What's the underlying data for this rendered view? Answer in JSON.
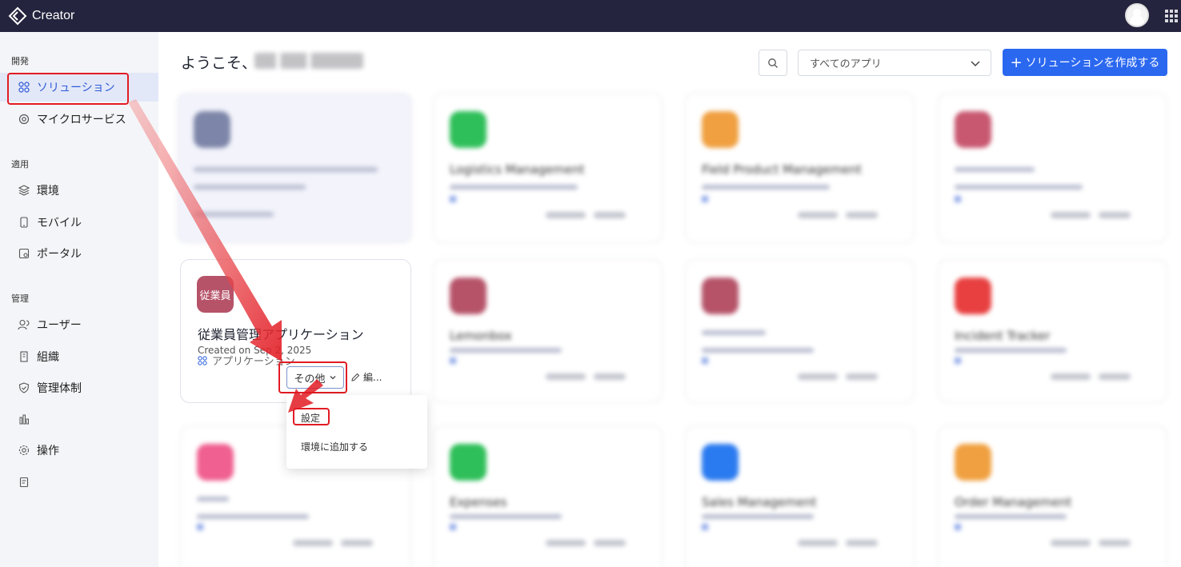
{
  "topbar": {
    "brand": "Creator",
    "logo_icon": "creator-logo-icon"
  },
  "sidebar": {
    "sections": [
      {
        "label": "開発",
        "items": [
          {
            "label": "ソリューション",
            "icon": "grid-icon",
            "active": true
          },
          {
            "label": "マイクロサービス",
            "icon": "cloud-icon"
          }
        ]
      },
      {
        "label": "適用",
        "items": [
          {
            "label": "環境",
            "icon": "layers-icon"
          },
          {
            "label": "モバイル",
            "icon": "mobile-icon"
          },
          {
            "label": "ポータル",
            "icon": "portal-icon"
          }
        ]
      },
      {
        "label": "管理",
        "items": [
          {
            "label": "ユーザー",
            "icon": "users-icon"
          },
          {
            "label": "組織",
            "icon": "building-icon"
          },
          {
            "label": "管理体制",
            "icon": "shield-icon"
          },
          {
            "label": "",
            "icon": "bar-chart-icon"
          },
          {
            "label": "操作",
            "icon": "gear-icon"
          },
          {
            "label": "",
            "icon": "document-icon"
          }
        ]
      }
    ]
  },
  "header": {
    "welcome": "ようこそ、",
    "filter_value": "すべてのアプリ",
    "create_label": "ソリューションを作成する"
  },
  "main_card": {
    "icon_text": "従業員",
    "title": "従業員管理アプリケーション",
    "created": "Created on Sep 2, 2025",
    "type_label": "アプリケーション",
    "more_label": "その他",
    "edit_label": "編..."
  },
  "dropdown": {
    "items": [
      "設定",
      "環境に追加する"
    ]
  },
  "blurred_cards": [
    {
      "title": "Logistics Management",
      "color": "#2fbf5a"
    },
    {
      "title": "Field Product Management",
      "color": "#f0a040"
    },
    {
      "title": "",
      "color": "#c85870"
    },
    {
      "title": "Lemonbox",
      "color": "#b65369"
    },
    {
      "title": "",
      "color": "#b65369"
    },
    {
      "title": "Incident Tracker",
      "color": "#e84040"
    },
    {
      "title": "",
      "color": "#f06090"
    },
    {
      "title": "Expenses",
      "color": "#2fbf5a"
    },
    {
      "title": "Sales Management",
      "color": "#2b7bf0"
    },
    {
      "title": "Order Management",
      "color": "#f0a040"
    }
  ],
  "colors": {
    "accent": "#2b68f0",
    "topbar": "#24243e",
    "highlight": "#e21b23"
  }
}
